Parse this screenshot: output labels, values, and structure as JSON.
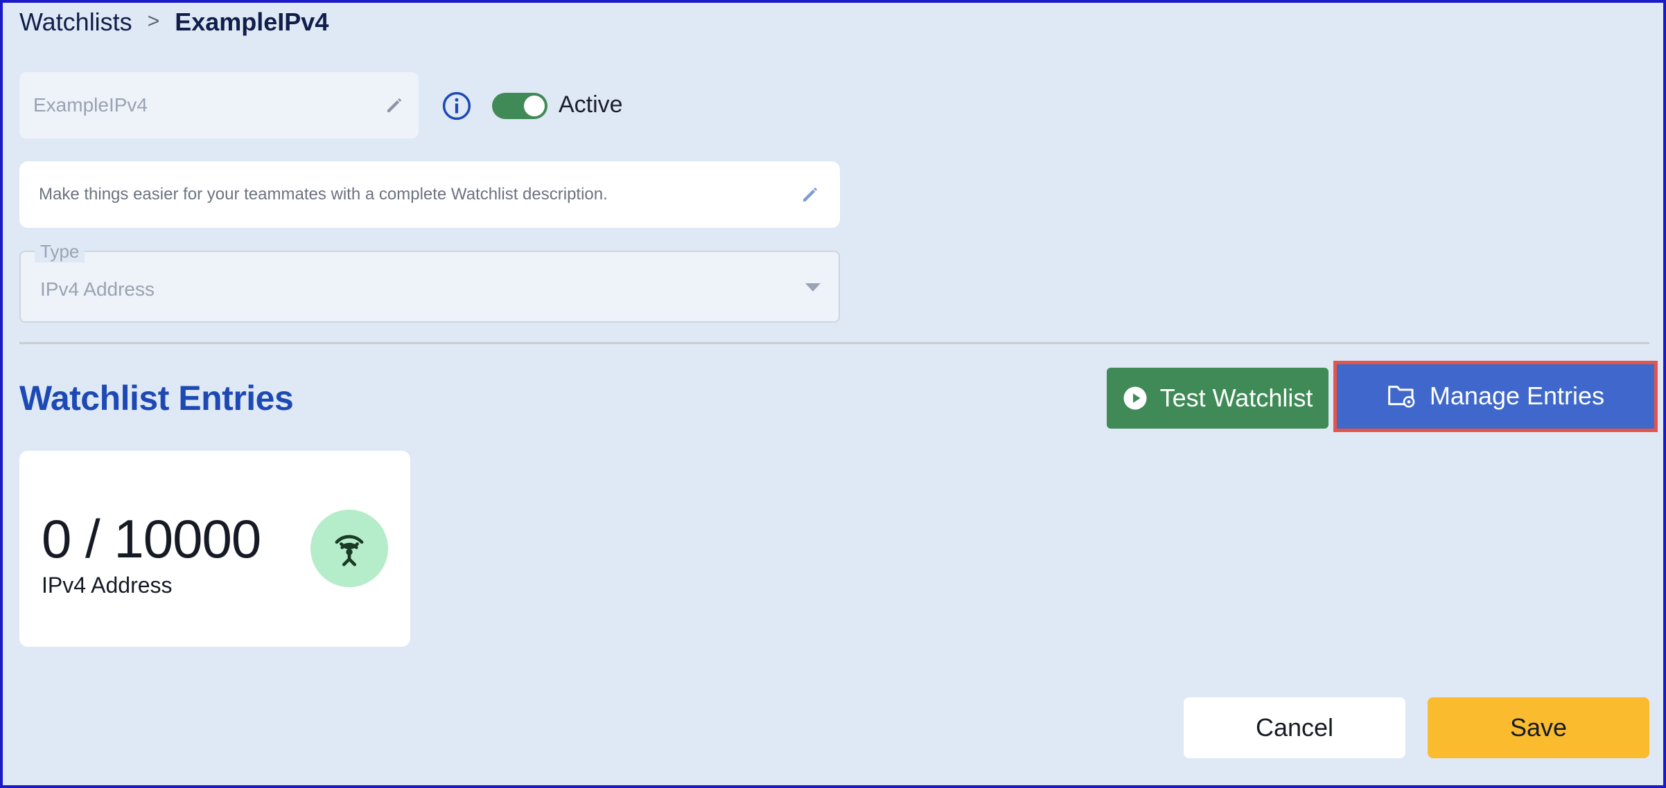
{
  "breadcrumb": {
    "parent": "Watchlists",
    "separator": ">",
    "current": "ExampleIPv4"
  },
  "form": {
    "name_value": "ExampleIPv4",
    "active_label": "Active",
    "active": true,
    "description_placeholder": "Make things easier for your teammates with a complete Watchlist description.",
    "type_label": "Type",
    "type_value": "IPv4 Address"
  },
  "entries": {
    "title": "Watchlist Entries",
    "test_button": "Test Watchlist",
    "manage_button": "Manage Entries",
    "count": "0 / 10000",
    "count_label": "IPv4 Address"
  },
  "footer": {
    "cancel": "Cancel",
    "save": "Save"
  },
  "colors": {
    "background": "#dfe8f5",
    "accent_blue": "#1d49b4",
    "green": "#3f8a56",
    "manage_blue": "#4068cc",
    "save_yellow": "#fbbb2e",
    "highlight_red": "#e5534b"
  },
  "icons": [
    "chevron-right-icon",
    "pencil-icon",
    "info-icon",
    "play-circle-icon",
    "folder-gear-icon",
    "antenna-icon",
    "chevron-down-icon"
  ]
}
